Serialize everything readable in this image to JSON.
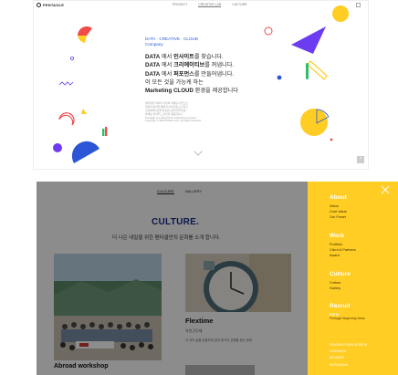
{
  "top": {
    "logo": "PENTAGLE",
    "nav": [
      "PROJECT",
      "CREATIVE LAB",
      "CULTURE"
    ],
    "tagline_1": "DATA · CREATIVE · CLOUD",
    "tagline_2": "Company",
    "lines": [
      {
        "bold": "DATA",
        "mid": " 에서 ",
        "bold2": "인사이트",
        "end": "를 찾습니다."
      },
      {
        "bold": "DATA",
        "mid": " 에서 ",
        "bold2": "크리에이티브",
        "end": "를 꺼냅니다."
      },
      {
        "bold": "DATA",
        "mid": " 에서 ",
        "bold2": "퍼포먼스",
        "end": "를 만들어냅니다."
      },
      {
        "bold": "",
        "mid": "이 모든 것을 가능케 하는",
        "bold2": "",
        "end": ""
      },
      {
        "bold": "Marketing CLOUD",
        "mid": " 환경을 제공합니다",
        "bold2": "",
        "end": ""
      }
    ],
    "small_lines": [
      "펜타클은 데이터 기반의 마케팅 기업으로",
      "데이터 분석을 통해 인사이트를 도출하고",
      "크리에이티브와 퍼포먼스를 만들어내는",
      "마케팅 클라우드 환경을 제공합니다",
      "Pentagle is a data-driven marketing company",
      "Copyright © PENTAGLE Corp. All rights reserved."
    ]
  },
  "bottom": {
    "subnav": [
      "CULTURE",
      "GALLERY"
    ],
    "title": "CULTURE.",
    "subtitle": "더 나은 내일을 위한 펜타클만의 문화를 소개 합니다.",
    "card1_title": "Abroad workshop",
    "card2_title": "Flextime",
    "card2_sub": "유연근무제",
    "card2_desc": "각 자의 삶을 존중하며 일과 휴식의 균형을 찾는 문화"
  },
  "panel": {
    "groups": [
      {
        "head": "About",
        "items": [
          "Vision",
          "Core Value",
          "Our Power"
        ]
      },
      {
        "head": "Work",
        "items": [
          "Portfolio",
          "Client & Partners",
          "Award"
        ]
      },
      {
        "head": "Culture",
        "items": [
          "Culture",
          "Gallery"
        ]
      },
      {
        "head": "Recruit",
        "items": [
          "P.E.N",
          "Pentagle Beginning News"
        ]
      }
    ],
    "footer": [
      "PENTAGLE NEW SCREEN",
      "FACEBOOK",
      "BEHANCE",
      "INSTAGRAM"
    ]
  },
  "colors": {
    "panel_yellow": "#ffcd24",
    "culture_blue": "#1a2a8a",
    "accent_blue": "#2a55d6",
    "shape_yellow": "#ffcd24",
    "shape_purple": "#6c3cf0",
    "shape_red": "#f04a4a",
    "shape_green": "#2ebd6b"
  }
}
